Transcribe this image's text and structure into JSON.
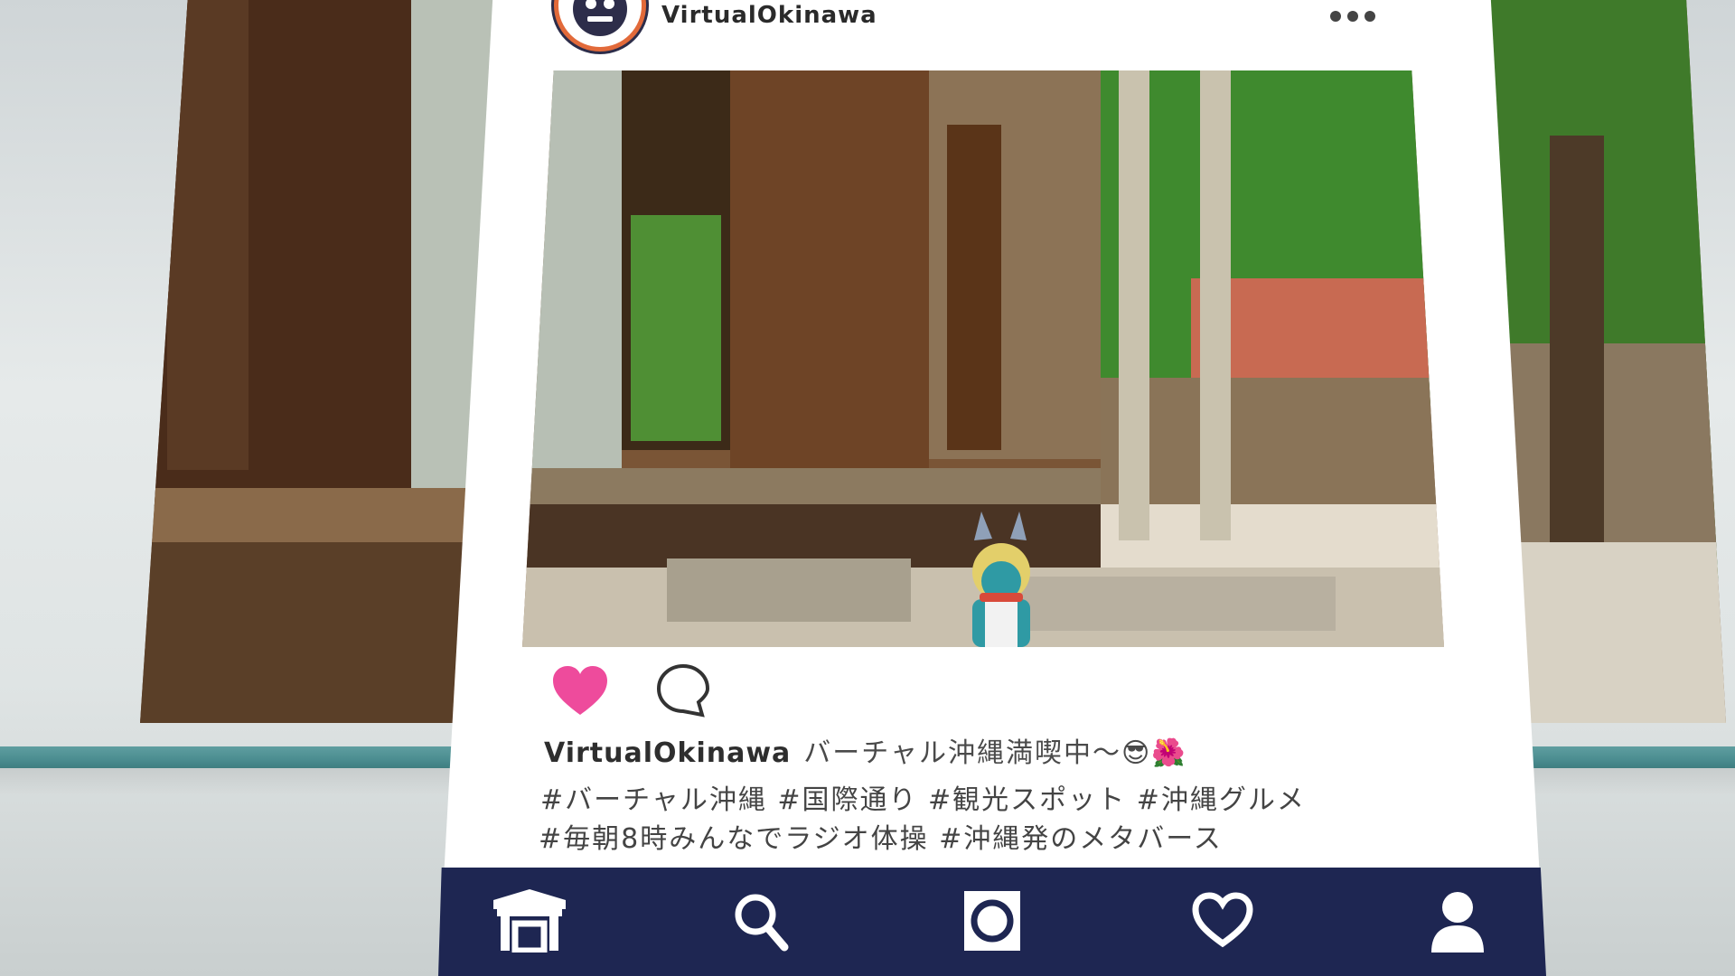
{
  "post": {
    "username": "VirtualOkinawa",
    "caption_user": "VirtualOkinawa",
    "caption_text": "バーチャル沖縄満喫中〜😎🌺",
    "hashtags_line1": "#バーチャル沖縄 #国際通り #観光スポット #沖縄グルメ",
    "hashtags_line2": "#毎朝8時みんなでラジオ体操 #沖縄発のメタバース",
    "liked": true
  },
  "header": {
    "avatar_icon": "shisa-logo-icon",
    "more_icon": "more-dots-icon"
  },
  "actions": {
    "like_icon": "heart-filled-icon",
    "comment_icon": "comment-bubble-icon"
  },
  "bottom_nav": {
    "items": [
      {
        "icon": "shop-icon",
        "label": ""
      },
      {
        "icon": "search-icon",
        "label": ""
      },
      {
        "icon": "camera-icon",
        "label": ""
      },
      {
        "icon": "heart-outline-icon",
        "label": ""
      },
      {
        "icon": "profile-icon",
        "label": ""
      }
    ]
  },
  "colors": {
    "like": "#ee4b9c",
    "nav_bar": "#1e2652",
    "rail": "#4b8d90",
    "card": "#ffffff"
  }
}
